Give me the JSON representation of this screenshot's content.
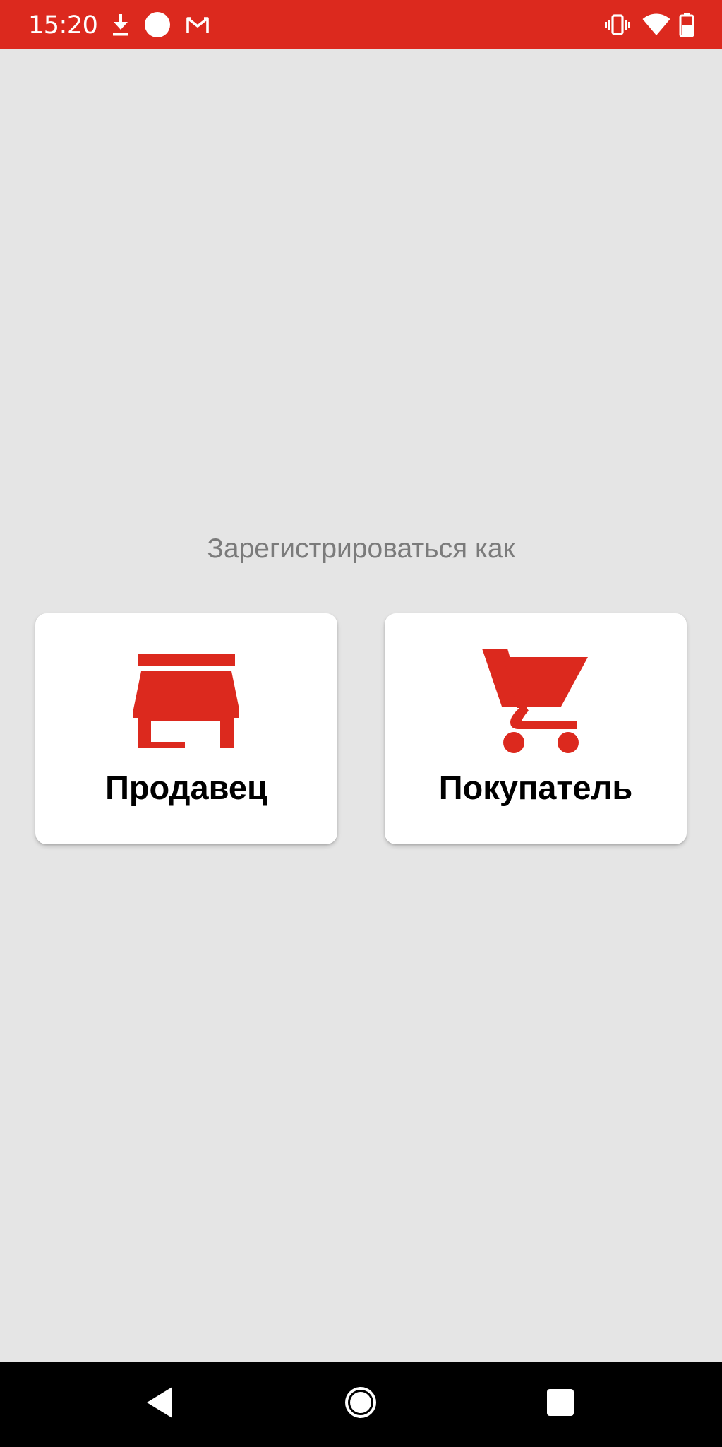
{
  "status_bar": {
    "time": "15:20",
    "left_icons": [
      "download-icon",
      "circle-notification-icon",
      "gmail-icon"
    ],
    "right_icons": [
      "vibrate-icon",
      "wifi-icon",
      "battery-icon"
    ]
  },
  "colors": {
    "accent": "#dc291e",
    "background": "#e5e5e5",
    "card": "#ffffff",
    "prompt_text": "#7b7b7b",
    "nav_bar": "#000000"
  },
  "register": {
    "prompt": "Зарегистрироваться как",
    "options": [
      {
        "label": "Продавец",
        "icon": "store-icon"
      },
      {
        "label": "Покупатель",
        "icon": "shopping-cart-icon"
      }
    ]
  },
  "nav_bar": {
    "buttons": [
      "back-icon",
      "home-icon",
      "recents-icon"
    ]
  }
}
